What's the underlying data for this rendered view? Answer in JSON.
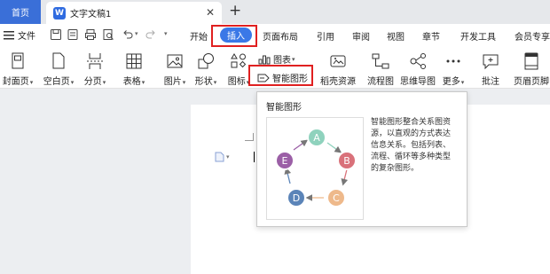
{
  "tabs": {
    "home": "首页",
    "doc_title": "文字文稿1",
    "close": "✕",
    "add": "+"
  },
  "menu": {
    "file": "文件",
    "items": [
      "开始",
      "插入",
      "页面布局",
      "引用",
      "审阅",
      "视图",
      "章节",
      "开发工具",
      "会员专享"
    ]
  },
  "toolbar": {
    "cover": "封面页",
    "blank": "空白页",
    "pagebreak": "分页",
    "table": "表格",
    "picture": "图片",
    "shape": "形状",
    "icon": "图标",
    "chart": "图表",
    "smartart": "智能图形",
    "stock": "稻壳资源",
    "flowchart": "流程图",
    "mindmap": "思维导图",
    "more": "更多",
    "comment": "批注",
    "header_footer": "页眉页脚"
  },
  "tooltip": {
    "title": "智能图形",
    "desc_lines": [
      "智能图形整合关系图资",
      "源，以直观的方式表达",
      "信息关系。包括列表、",
      "流程、循环等多种类型",
      "的复杂图形。"
    ],
    "nodes": [
      "A",
      "B",
      "C",
      "D",
      "E"
    ]
  },
  "colors": {
    "accent": "#3a78e7",
    "highlight": "#e02020",
    "node_a": "#8fd2bd",
    "node_b": "#d9717a",
    "node_c": "#eeb98b",
    "node_d": "#5b84b8",
    "node_e": "#9b5fa6"
  }
}
